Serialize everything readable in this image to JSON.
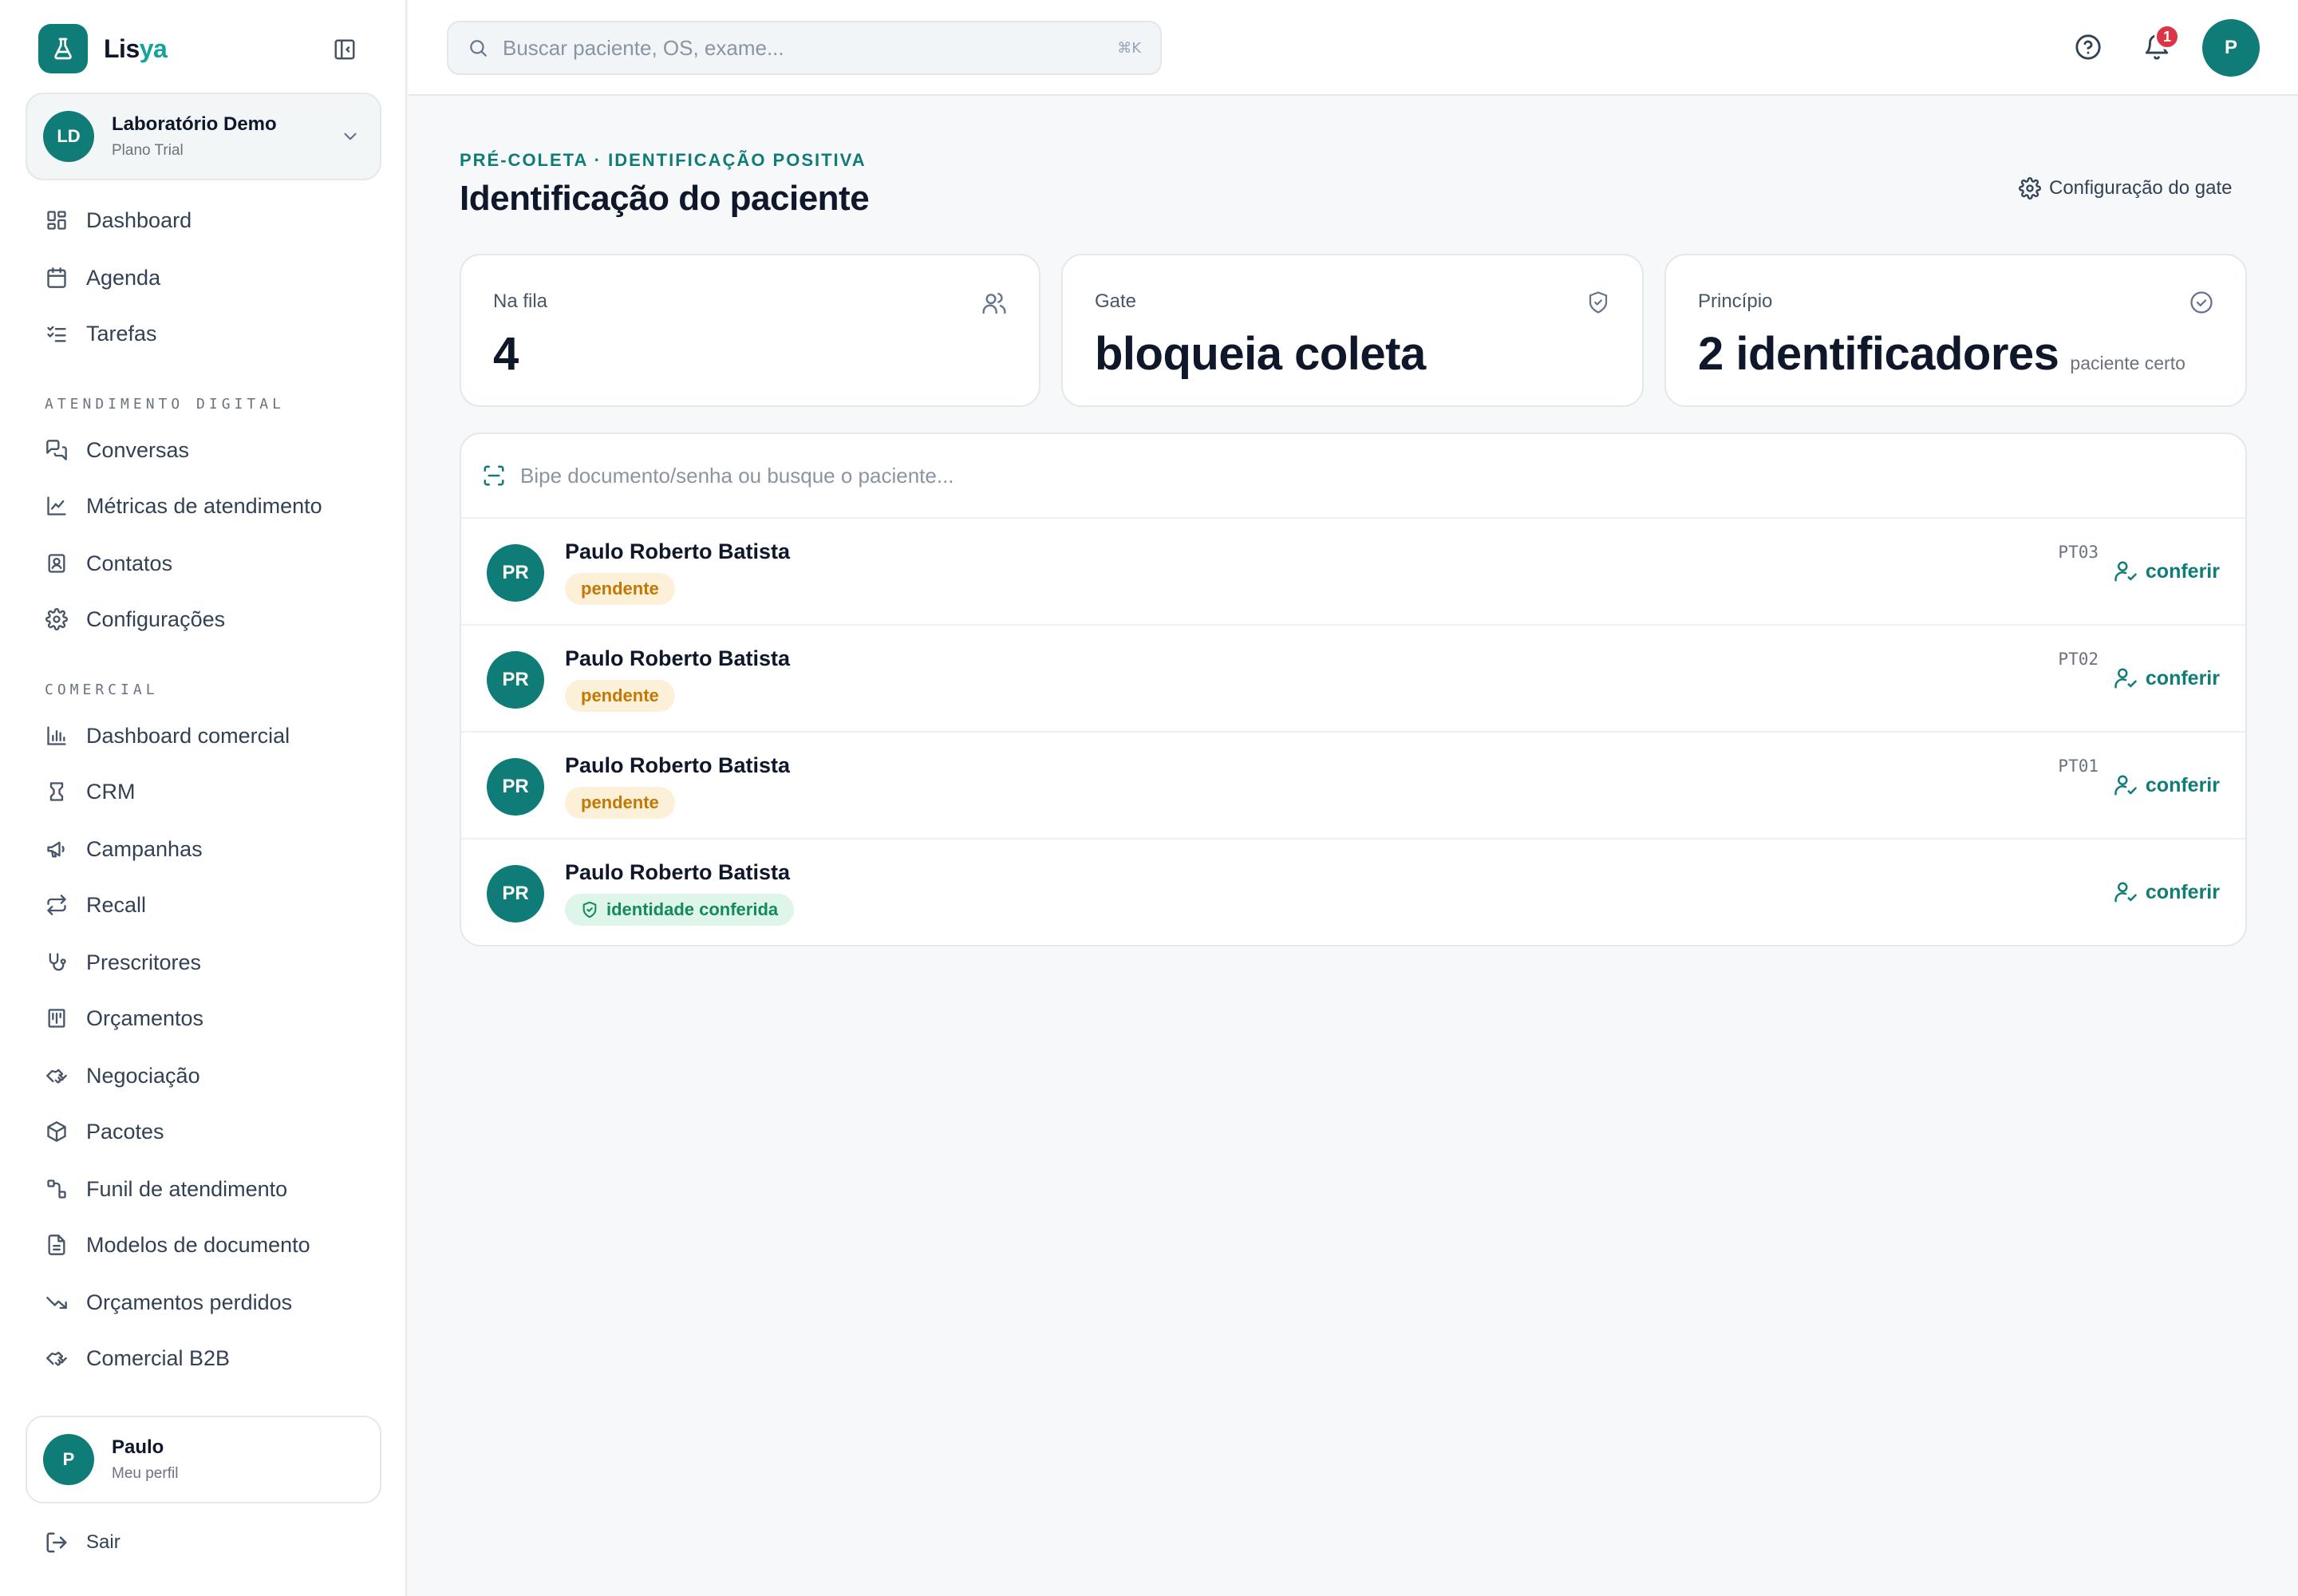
{
  "brand": {
    "name_part1": "Lis",
    "name_part2": "ya"
  },
  "organization": {
    "initials": "LD",
    "name": "Laboratório Demo",
    "plan": "Plano Trial"
  },
  "nav": {
    "main": [
      {
        "label": "Dashboard",
        "icon": "dashboard-icon"
      },
      {
        "label": "Agenda",
        "icon": "calendar-icon"
      },
      {
        "label": "Tarefas",
        "icon": "checklist-icon"
      }
    ],
    "section_digital": "ATENDIMENTO DIGITAL",
    "digital": [
      {
        "label": "Conversas",
        "icon": "chat-icon"
      },
      {
        "label": "Métricas de atendimento",
        "icon": "line-chart-icon"
      },
      {
        "label": "Contatos",
        "icon": "contacts-icon"
      },
      {
        "label": "Configurações",
        "icon": "gear-icon"
      }
    ],
    "section_comercial": "COMERCIAL",
    "comercial": [
      {
        "label": "Dashboard comercial",
        "icon": "bar-chart-icon"
      },
      {
        "label": "CRM",
        "icon": "crm-icon"
      },
      {
        "label": "Campanhas",
        "icon": "megaphone-icon"
      },
      {
        "label": "Recall",
        "icon": "repeat-icon"
      },
      {
        "label": "Prescritores",
        "icon": "stethoscope-icon"
      },
      {
        "label": "Orçamentos",
        "icon": "receipt-icon"
      },
      {
        "label": "Negociação",
        "icon": "handshake-icon"
      },
      {
        "label": "Pacotes",
        "icon": "package-icon"
      },
      {
        "label": "Funil de atendimento",
        "icon": "funnel-icon"
      },
      {
        "label": "Modelos de documento",
        "icon": "document-icon"
      },
      {
        "label": "Orçamentos perdidos",
        "icon": "trending-down-icon"
      },
      {
        "label": "Comercial B2B",
        "icon": "handshake-icon"
      }
    ]
  },
  "profile": {
    "initial": "P",
    "name": "Paulo",
    "sub": "Meu perfil"
  },
  "logout_label": "Sair",
  "topbar": {
    "search_placeholder": "Buscar paciente, OS, exame...",
    "shortcut": "⌘K",
    "notifications_count": "1",
    "user_initial": "P"
  },
  "page": {
    "eyebrow": "PRÉ-COLETA · IDENTIFICAÇÃO POSITIVA",
    "title": "Identificação do paciente",
    "gate_config_label": "Configuração do gate"
  },
  "stats": [
    {
      "label": "Na fila",
      "value": "4",
      "sub": "",
      "icon": "users-icon"
    },
    {
      "label": "Gate",
      "value": "bloqueia coleta",
      "sub": "",
      "icon": "shield-icon"
    },
    {
      "label": "Princípio",
      "value": "2 identificadores",
      "sub": "paciente certo",
      "icon": "check-circle-icon"
    }
  ],
  "queue": {
    "scan_placeholder": "Bipe documento/senha ou busque o paciente...",
    "action_label": "conferir",
    "rows": [
      {
        "initials": "PR",
        "name": "Paulo Roberto Batista",
        "status": "pendente",
        "status_type": "pending",
        "code": "PT03"
      },
      {
        "initials": "PR",
        "name": "Paulo Roberto Batista",
        "status": "pendente",
        "status_type": "pending",
        "code": "PT02"
      },
      {
        "initials": "PR",
        "name": "Paulo Roberto Batista",
        "status": "pendente",
        "status_type": "pending",
        "code": "PT01"
      },
      {
        "initials": "PR",
        "name": "Paulo Roberto Batista",
        "status": "identidade conferida",
        "status_type": "ok",
        "code": ""
      }
    ]
  },
  "colors": {
    "accent": "#0f7c77",
    "pending": "#c27803",
    "ok": "#138a5a",
    "badge": "#dc3545"
  }
}
